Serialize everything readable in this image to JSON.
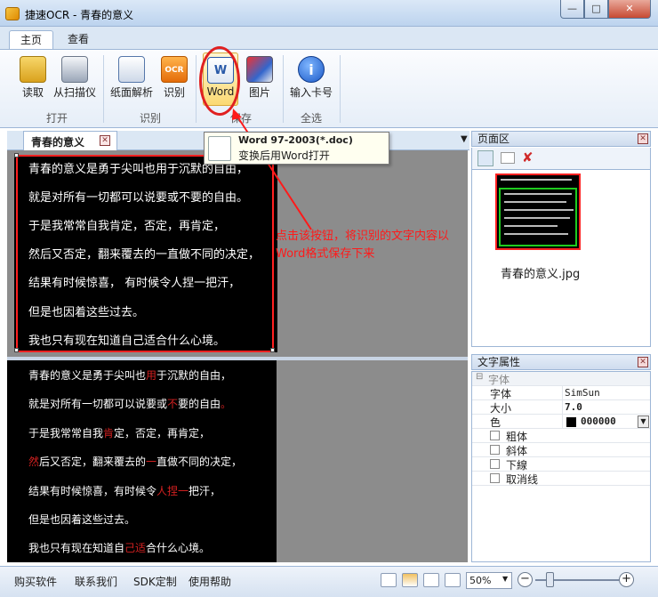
{
  "window": {
    "title": "捷速OCR - 青春的意义"
  },
  "ribbon": {
    "tabs": [
      "主页",
      "查看"
    ],
    "groups": [
      {
        "label": "打开",
        "buttons": [
          "读取",
          "从扫描仪"
        ]
      },
      {
        "label": "识别",
        "buttons": [
          "纸面解析",
          "识别"
        ]
      },
      {
        "label": "保存",
        "buttons": [
          "Word",
          "图片"
        ]
      },
      {
        "label": "全选",
        "buttons": [
          "输入卡号"
        ]
      }
    ]
  },
  "tooltip": {
    "title": "Word 97-2003(*.doc)",
    "description": "变换后用Word打开"
  },
  "annotation": {
    "text": "点击该按钮，将识别的文字内容以Word格式保存下来"
  },
  "document": {
    "tab_label": "青春的意义",
    "image_lines": [
      "青春的意义是勇于尖叫也用于沉默的自由，",
      "就是对所有一切都可以说要或不要的自由。",
      "于是我常常自我肯定，否定，再肯定，",
      "然后又否定，翻来覆去的一直做不同的决定，",
      "结果有时候惊喜， 有时候令人捏一把汗，",
      "但是也因着这些过去。",
      "我也只有现在知道自己适合什么心境。"
    ],
    "text_lines": [
      [
        {
          "t": "青春的意义是勇于尖叫也"
        },
        {
          "t": "用",
          "red": true
        },
        {
          "t": "于沉默的自由，"
        }
      ],
      [
        {
          "t": "就是对所有一切都可以说要或"
        },
        {
          "t": "不",
          "red": true
        },
        {
          "t": "要的自由"
        },
        {
          "t": "。",
          "red": true
        }
      ],
      [
        {
          "t": "于是我常常自我"
        },
        {
          "t": "肯",
          "red": true
        },
        {
          "t": "定，否定，再肯定，"
        }
      ],
      [
        {
          "t": "然",
          "red": true
        },
        {
          "t": "后又否定，翻来覆去的"
        },
        {
          "t": "一",
          "red": true
        },
        {
          "t": "直做不同的决定，"
        }
      ],
      [
        {
          "t": "结果有时候惊喜，有时候令"
        },
        {
          "t": "人捏一",
          "red": true
        },
        {
          "t": "把汗，"
        }
      ],
      [
        {
          "t": "但是也因着这些过去。"
        }
      ],
      [
        {
          "t": "我也只有现在知道自"
        },
        {
          "t": "己适",
          "red": true
        },
        {
          "t": "合什么心境。"
        }
      ]
    ]
  },
  "page_pane": {
    "title": "页面区",
    "thumbnail_label": "青春的意义.jpg"
  },
  "text_props": {
    "title": "文字属性",
    "section": "字体",
    "rows": [
      {
        "name": "字体",
        "value": "SimSun"
      },
      {
        "name": "大小",
        "value": "7.0"
      },
      {
        "name": "色",
        "value": "000000"
      }
    ],
    "checks": [
      "粗体",
      "斜体",
      "下線",
      "取消线"
    ]
  },
  "statusbar": {
    "links": [
      "购买软件",
      "联系我们",
      "SDK定制",
      "使用帮助"
    ],
    "zoom": "50%"
  },
  "colors": {
    "annotation": "#ff1a1a",
    "highlight": "#ff2020",
    "thumb_border": "#1ecb1e"
  }
}
